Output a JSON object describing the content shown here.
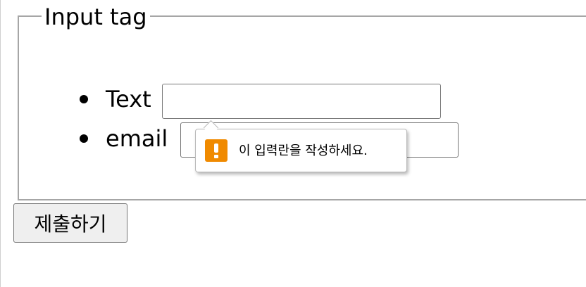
{
  "form": {
    "legend": "Input tag",
    "fields": [
      {
        "label": "Text",
        "value": "",
        "placeholder": ""
      },
      {
        "label": "email",
        "value": "",
        "placeholder": ""
      }
    ],
    "submit_label": "제출하기"
  },
  "validation_tooltip": {
    "icon": "warning-icon",
    "message": "이 입력란을 작성하세요.",
    "icon_color": "#f08a00"
  }
}
